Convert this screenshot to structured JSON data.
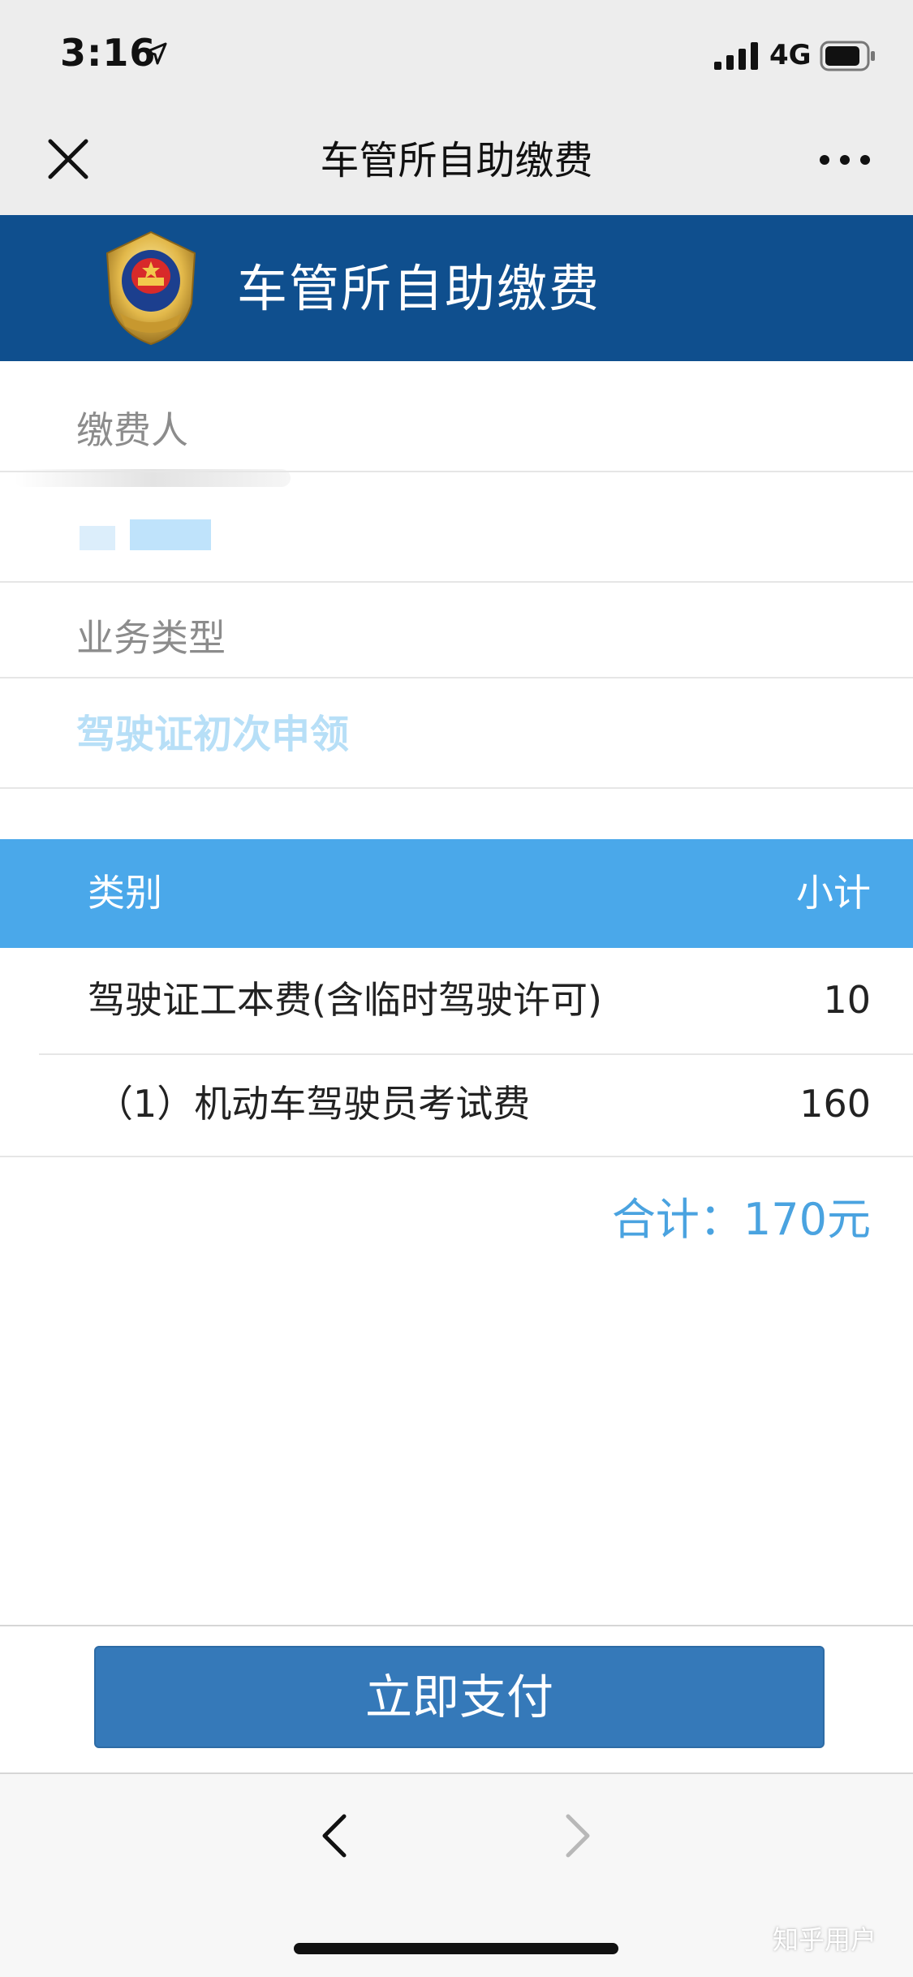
{
  "status_bar": {
    "time": "3:16",
    "network": "4G"
  },
  "nav": {
    "title": "车管所自助缴费"
  },
  "banner": {
    "title": "车管所自助缴费"
  },
  "form": {
    "payer_label": "缴费人",
    "business_type_label": "业务类型",
    "business_type_value": "驾驶证初次申领"
  },
  "fee_table": {
    "header_category": "类别",
    "header_subtotal": "小计",
    "rows": [
      {
        "label": "驾驶证工本费(含临时驾驶许可)",
        "value": "10"
      },
      {
        "label": "（1）机动车驾驶员考试费",
        "value": "160"
      }
    ],
    "total": "合计：170元"
  },
  "actions": {
    "pay_label": "立即支付"
  },
  "watermark": "知乎用户",
  "colors": {
    "banner": "#0f4f8e",
    "table_header": "#4aa8ea",
    "pay_button": "#3579b9",
    "total_text": "#4aa3e0"
  }
}
